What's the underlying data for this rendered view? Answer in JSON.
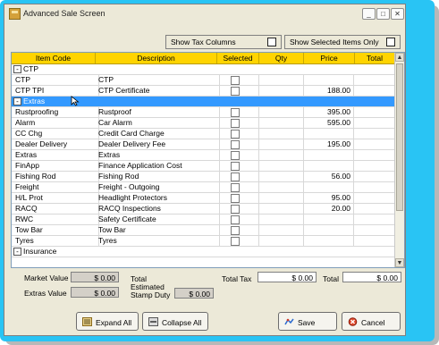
{
  "window": {
    "title": "Advanced Sale Screen",
    "minimize_glyph": "_",
    "restore_glyph": "□",
    "close_glyph": "✕"
  },
  "toggles": {
    "show_tax_columns": "Show Tax Columns",
    "show_selected_only": "Show Selected Items Only"
  },
  "grid": {
    "columns": [
      "Item Code",
      "Description",
      "Selected",
      "Qty",
      "Price",
      "Total"
    ],
    "groups": [
      {
        "name": "CTP",
        "expander": "-",
        "items": [
          {
            "code": "CTP",
            "description": "CTP",
            "price": ""
          },
          {
            "code": "CTP TPI",
            "description": "CTP Certificate",
            "price": "188.00"
          }
        ]
      },
      {
        "name": "Extras",
        "expander": "-",
        "items": [
          {
            "code": "Rustproofing",
            "description": "Rustproof",
            "price": "395.00"
          },
          {
            "code": "Alarm",
            "description": "Car Alarm",
            "price": "595.00"
          },
          {
            "code": "CC Chg",
            "description": "Credit Card Charge",
            "price": ""
          },
          {
            "code": "Dealer Delivery",
            "description": "Dealer Delivery Fee",
            "price": "195.00"
          },
          {
            "code": "Extras",
            "description": "Extras",
            "price": ""
          },
          {
            "code": "FinApp",
            "description": "Finance Application Cost",
            "price": ""
          },
          {
            "code": "Fishing Rod",
            "description": "Fishing Rod",
            "price": "56.00"
          },
          {
            "code": "Freight",
            "description": "Freight - Outgoing",
            "price": ""
          },
          {
            "code": "H/L Prot",
            "description": "Headlight Protectors",
            "price": "95.00"
          },
          {
            "code": "RACQ",
            "description": "RACQ Inspections",
            "price": "20.00"
          },
          {
            "code": "RWC",
            "description": "Safety Certificate",
            "price": ""
          },
          {
            "code": "Tow Bar",
            "description": "Tow Bar",
            "price": ""
          },
          {
            "code": "Tyres",
            "description": "Tyres",
            "price": ""
          }
        ]
      },
      {
        "name": "Insurance",
        "expander": "-",
        "items": []
      }
    ],
    "scroll_up": "▲",
    "scroll_down": "▼"
  },
  "totals": {
    "market_value_label": "Market Value",
    "market_value": "$ 0.00",
    "extras_value_label": "Extras Value",
    "extras_value": "$ 0.00",
    "total_estimated_label_1": "Total",
    "total_estimated_label_2": "Estimated",
    "total_estimated_label_3": "Stamp Duty",
    "stamp_duty": "$ 0.00",
    "total_tax_label": "Total Tax",
    "total_tax": "$ 0.00",
    "total_label": "Total",
    "total": "$ 0.00"
  },
  "buttons": {
    "expand_all": "Expand All",
    "collapse_all": "Collapse All",
    "save": "Save",
    "cancel": "Cancel"
  },
  "colors": {
    "frame": "#29c4f4",
    "header": "#ffd400",
    "selection": "#3399ff"
  }
}
